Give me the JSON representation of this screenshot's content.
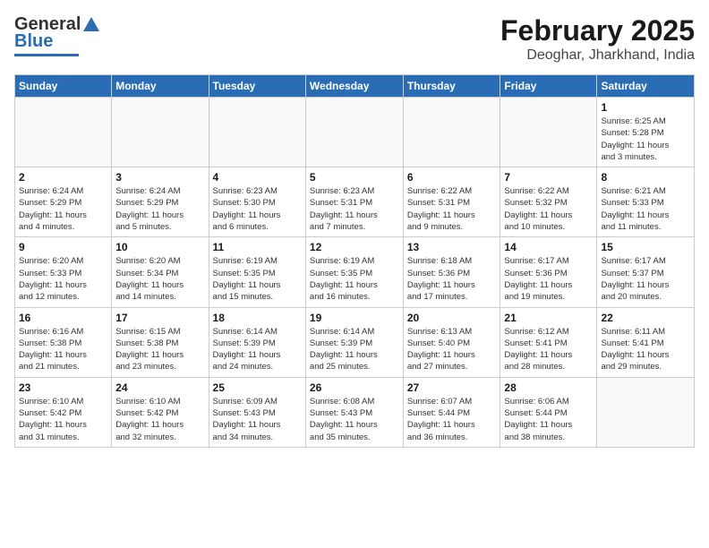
{
  "header": {
    "logo": {
      "line1": "General",
      "line2": "Blue"
    },
    "title": "February 2025",
    "subtitle": "Deoghar, Jharkhand, India"
  },
  "weekdays": [
    "Sunday",
    "Monday",
    "Tuesday",
    "Wednesday",
    "Thursday",
    "Friday",
    "Saturday"
  ],
  "weeks": [
    [
      {
        "day": "",
        "info": ""
      },
      {
        "day": "",
        "info": ""
      },
      {
        "day": "",
        "info": ""
      },
      {
        "day": "",
        "info": ""
      },
      {
        "day": "",
        "info": ""
      },
      {
        "day": "",
        "info": ""
      },
      {
        "day": "1",
        "info": "Sunrise: 6:25 AM\nSunset: 5:28 PM\nDaylight: 11 hours\nand 3 minutes."
      }
    ],
    [
      {
        "day": "2",
        "info": "Sunrise: 6:24 AM\nSunset: 5:29 PM\nDaylight: 11 hours\nand 4 minutes."
      },
      {
        "day": "3",
        "info": "Sunrise: 6:24 AM\nSunset: 5:29 PM\nDaylight: 11 hours\nand 5 minutes."
      },
      {
        "day": "4",
        "info": "Sunrise: 6:23 AM\nSunset: 5:30 PM\nDaylight: 11 hours\nand 6 minutes."
      },
      {
        "day": "5",
        "info": "Sunrise: 6:23 AM\nSunset: 5:31 PM\nDaylight: 11 hours\nand 7 minutes."
      },
      {
        "day": "6",
        "info": "Sunrise: 6:22 AM\nSunset: 5:31 PM\nDaylight: 11 hours\nand 9 minutes."
      },
      {
        "day": "7",
        "info": "Sunrise: 6:22 AM\nSunset: 5:32 PM\nDaylight: 11 hours\nand 10 minutes."
      },
      {
        "day": "8",
        "info": "Sunrise: 6:21 AM\nSunset: 5:33 PM\nDaylight: 11 hours\nand 11 minutes."
      }
    ],
    [
      {
        "day": "9",
        "info": "Sunrise: 6:20 AM\nSunset: 5:33 PM\nDaylight: 11 hours\nand 12 minutes."
      },
      {
        "day": "10",
        "info": "Sunrise: 6:20 AM\nSunset: 5:34 PM\nDaylight: 11 hours\nand 14 minutes."
      },
      {
        "day": "11",
        "info": "Sunrise: 6:19 AM\nSunset: 5:35 PM\nDaylight: 11 hours\nand 15 minutes."
      },
      {
        "day": "12",
        "info": "Sunrise: 6:19 AM\nSunset: 5:35 PM\nDaylight: 11 hours\nand 16 minutes."
      },
      {
        "day": "13",
        "info": "Sunrise: 6:18 AM\nSunset: 5:36 PM\nDaylight: 11 hours\nand 17 minutes."
      },
      {
        "day": "14",
        "info": "Sunrise: 6:17 AM\nSunset: 5:36 PM\nDaylight: 11 hours\nand 19 minutes."
      },
      {
        "day": "15",
        "info": "Sunrise: 6:17 AM\nSunset: 5:37 PM\nDaylight: 11 hours\nand 20 minutes."
      }
    ],
    [
      {
        "day": "16",
        "info": "Sunrise: 6:16 AM\nSunset: 5:38 PM\nDaylight: 11 hours\nand 21 minutes."
      },
      {
        "day": "17",
        "info": "Sunrise: 6:15 AM\nSunset: 5:38 PM\nDaylight: 11 hours\nand 23 minutes."
      },
      {
        "day": "18",
        "info": "Sunrise: 6:14 AM\nSunset: 5:39 PM\nDaylight: 11 hours\nand 24 minutes."
      },
      {
        "day": "19",
        "info": "Sunrise: 6:14 AM\nSunset: 5:39 PM\nDaylight: 11 hours\nand 25 minutes."
      },
      {
        "day": "20",
        "info": "Sunrise: 6:13 AM\nSunset: 5:40 PM\nDaylight: 11 hours\nand 27 minutes."
      },
      {
        "day": "21",
        "info": "Sunrise: 6:12 AM\nSunset: 5:41 PM\nDaylight: 11 hours\nand 28 minutes."
      },
      {
        "day": "22",
        "info": "Sunrise: 6:11 AM\nSunset: 5:41 PM\nDaylight: 11 hours\nand 29 minutes."
      }
    ],
    [
      {
        "day": "23",
        "info": "Sunrise: 6:10 AM\nSunset: 5:42 PM\nDaylight: 11 hours\nand 31 minutes."
      },
      {
        "day": "24",
        "info": "Sunrise: 6:10 AM\nSunset: 5:42 PM\nDaylight: 11 hours\nand 32 minutes."
      },
      {
        "day": "25",
        "info": "Sunrise: 6:09 AM\nSunset: 5:43 PM\nDaylight: 11 hours\nand 34 minutes."
      },
      {
        "day": "26",
        "info": "Sunrise: 6:08 AM\nSunset: 5:43 PM\nDaylight: 11 hours\nand 35 minutes."
      },
      {
        "day": "27",
        "info": "Sunrise: 6:07 AM\nSunset: 5:44 PM\nDaylight: 11 hours\nand 36 minutes."
      },
      {
        "day": "28",
        "info": "Sunrise: 6:06 AM\nSunset: 5:44 PM\nDaylight: 11 hours\nand 38 minutes."
      },
      {
        "day": "",
        "info": ""
      }
    ]
  ]
}
